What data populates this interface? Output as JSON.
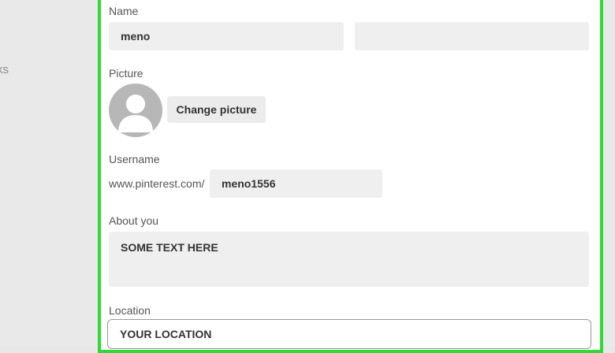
{
  "sidebar": {
    "partial_text": "ks"
  },
  "form": {
    "name": {
      "label": "Name",
      "first_value": "meno",
      "last_value": ""
    },
    "picture": {
      "label": "Picture",
      "change_button": "Change picture"
    },
    "username": {
      "label": "Username",
      "url_prefix": "www.pinterest.com/",
      "value": "meno1556"
    },
    "about": {
      "label": "About you",
      "value": "SOME TEXT HERE"
    },
    "location": {
      "label": "Location",
      "value": "YOUR LOCATION"
    }
  },
  "colors": {
    "highlight_border": "#2ddb35",
    "field_background": "#efefef",
    "avatar_gray": "#b7b7b7"
  },
  "icons": {
    "avatar": "person-avatar-icon"
  }
}
